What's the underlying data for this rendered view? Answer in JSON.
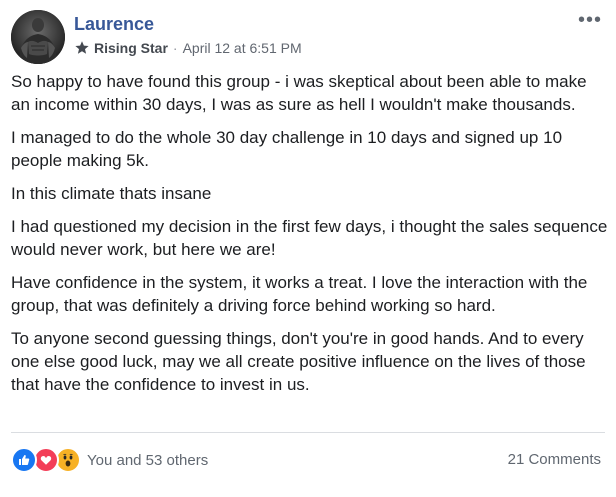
{
  "post": {
    "author": {
      "name": "Laurence",
      "avatar_icon": "profile-photo"
    },
    "badge": {
      "icon": "star-icon",
      "label": "Rising Star"
    },
    "separator": "·",
    "timestamp": "April 12 at 6:51 PM",
    "more_icon": "more-options-icon",
    "more_label": "•••",
    "paragraphs": [
      "So happy to have found this group - i was skeptical about been able to make an income within 30 days, I was as sure as hell I wouldn't make thousands.",
      "I managed to do the whole 30 day challenge in 10 days and signed up 10 people making 5k.",
      "In this climate thats insane",
      "I had questioned my decision in the first few days, i thought the sales sequence would never work, but here we are!",
      "Have confidence in the system, it works a treat. I love the interaction with the group, that was definitely a driving force behind working so hard.",
      "To anyone second guessing things, don't you're in good hands. And to every one else good luck, may we all create positive influence on the lives of those that have the confidence to invest in us."
    ]
  },
  "footer": {
    "reactions": [
      {
        "type": "like",
        "icon": "like-icon",
        "color": "#1877f2"
      },
      {
        "type": "love",
        "icon": "love-icon",
        "color": "#f33e58"
      },
      {
        "type": "wow",
        "icon": "wow-icon",
        "color": "#f7b125"
      }
    ],
    "reaction_text": "You and 53 others",
    "comments_text": "21 Comments"
  },
  "colors": {
    "author_name": "#385898",
    "body_text": "#1c1e21",
    "meta_text": "#616770",
    "divider": "#dadde1"
  }
}
